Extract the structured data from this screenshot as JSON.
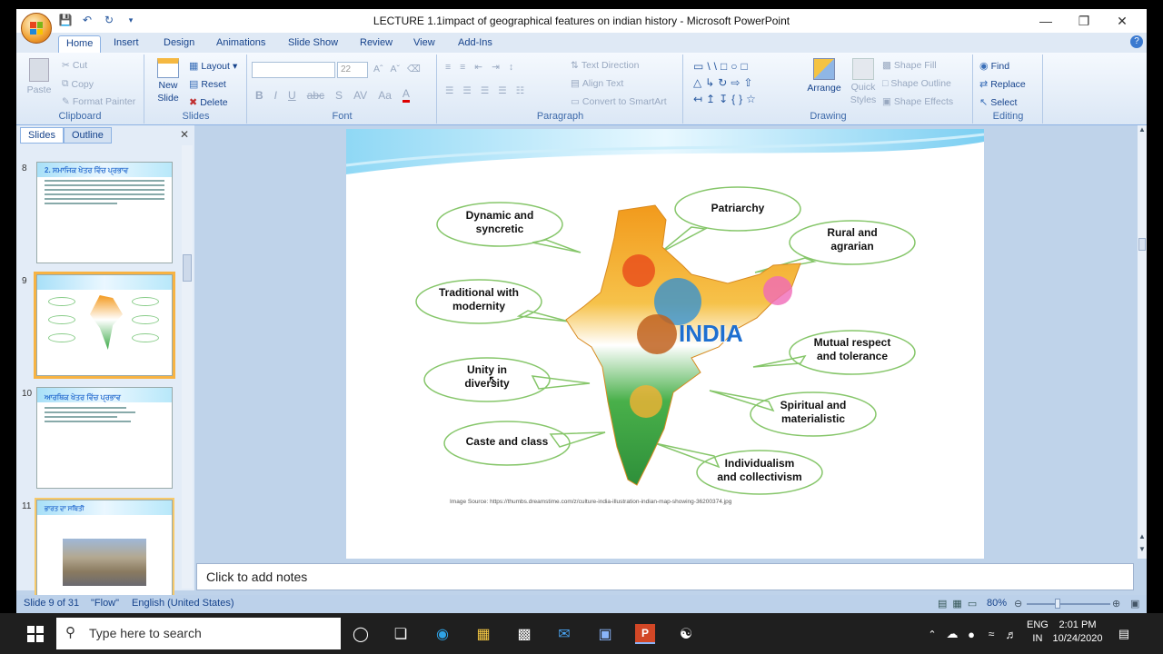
{
  "window": {
    "title": "LECTURE 1.1impact of geographical features on indian history - Microsoft PowerPoint"
  },
  "ribbon_tabs": [
    "Home",
    "Insert",
    "Design",
    "Animations",
    "Slide Show",
    "Review",
    "View",
    "Add-Ins"
  ],
  "clipboard": {
    "paste": "Paste",
    "cut": "Cut",
    "copy": "Copy",
    "format_painter": "Format Painter",
    "label": "Clipboard"
  },
  "slides_group": {
    "new_slide": "New",
    "new_slide2": "Slide",
    "layout": "Layout",
    "reset": "Reset",
    "delete": "Delete",
    "label": "Slides"
  },
  "font_group": {
    "size": "22",
    "label": "Font"
  },
  "paragraph_group": {
    "text_direction": "Text Direction",
    "align_text": "Align Text",
    "convert": "Convert to SmartArt",
    "label": "Paragraph"
  },
  "drawing_group": {
    "arrange": "Arrange",
    "quick_styles": "Quick",
    "quick_styles2": "Styles",
    "shape_fill": "Shape Fill",
    "shape_outline": "Shape Outline",
    "shape_effects": "Shape Effects",
    "label": "Drawing"
  },
  "editing_group": {
    "find": "Find",
    "replace": "Replace",
    "select": "Select",
    "label": "Editing"
  },
  "side_pane": {
    "tab_slides": "Slides",
    "tab_outline": "Outline",
    "thumbs": [
      {
        "num": "8",
        "title": "2. ਸਮਾਜਿਕ ਖੇਤਰ ਵਿੱਚ ਪ੍ਰਭਾਵ"
      },
      {
        "num": "9",
        "title": ""
      },
      {
        "num": "10",
        "title": "ਆਰਥਿਕ ਖੇਤਰ ਵਿੱਚ ਪ੍ਰਭਾਵ"
      },
      {
        "num": "11",
        "title": "ਭਾਰਤ ਦਾ ਸਥਿਤੀ"
      }
    ]
  },
  "slide": {
    "bubbles": [
      {
        "l1": "Dynamic and",
        "l2": "syncretic"
      },
      {
        "l1": "Patriarchy",
        "l2": ""
      },
      {
        "l1": "Rural and",
        "l2": "agrarian"
      },
      {
        "l1": "Traditional with",
        "l2": "modernity"
      },
      {
        "l1": "Mutual respect",
        "l2": "and tolerance"
      },
      {
        "l1": "Unity in",
        "l2": "diversity"
      },
      {
        "l1": "Spiritual and",
        "l2": "materialistic"
      },
      {
        "l1": "Caste and class",
        "l2": ""
      },
      {
        "l1": "Individualism",
        "l2": "and collectivism"
      }
    ],
    "map_label": "INDIA",
    "source": "Image Source: https://thumbs.dreamstime.com/z/culture-india-illustration-indian-map-showing-36200374.jpg"
  },
  "notes": {
    "placeholder": "Click to add notes"
  },
  "status": {
    "slide": "Slide 9 of 31",
    "theme": "\"Flow\"",
    "language": "English (United States)",
    "zoom": "80%"
  },
  "taskbar": {
    "search": "Type here to search",
    "lang1": "ENG",
    "lang2": "IN",
    "time": "2:01 PM",
    "date": "10/24/2020"
  }
}
